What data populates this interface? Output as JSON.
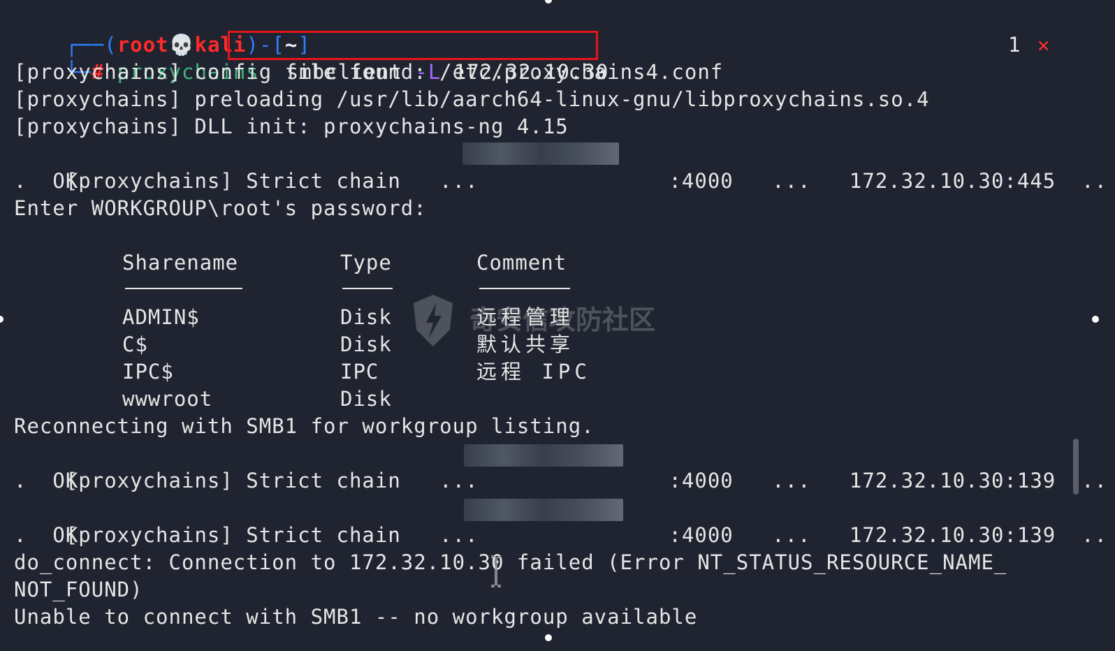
{
  "prompt": {
    "top_open": "┌──(",
    "user": "root",
    "skull": "💀",
    "host": "kali",
    "top_close": ")-[",
    "dir": "~",
    "bracket_close": "]",
    "bottom": "└─",
    "hash": "#",
    "proxy_word": "proxychains"
  },
  "command": {
    "program": "smbclient",
    "flag": "-L",
    "target": "172.32.10.30"
  },
  "right_status": {
    "exit_code": "1",
    "error_mark": "✕"
  },
  "output": {
    "l1": "[proxychains] config file found: /etc/proxychains4.conf",
    "l2": "[proxychains] preloading /usr/lib/aarch64-linux-gnu/libproxychains.so.4",
    "l3": "[proxychains] DLL init: proxychains-ng 4.15",
    "l4a": "[proxychains] Strict chain   ...  ",
    "l4b": ":4000   ...   172.32.10.30:445  ..",
    "l5": ".  OK",
    "l6": "Enter WORKGROUP\\root's password:",
    "l11": "Reconnecting with SMB1 for workgroup listing.",
    "l12a": "[proxychains] Strict chain   ...  ",
    "l12b": ":4000   ...   172.32.10.30:139  ..",
    "l13": ".  OK",
    "l14a": "[proxychains] Strict chain   ...  ",
    "l14b": ":4000   ...   172.32.10.30:139  ..",
    "l15": ".  OK",
    "l16": "do_connect: Connection to 172.32.10.30 failed (Error NT_STATUS_RESOURCE_NAME_",
    "l17": "NOT_FOUND)",
    "l18": "Unable to connect with SMB1 -- no workgroup available"
  },
  "shares_table": {
    "headers": [
      "Sharename",
      "Type",
      "Comment"
    ],
    "rows": [
      {
        "name": "ADMIN$",
        "type": "Disk",
        "comment": "远程管理"
      },
      {
        "name": "C$",
        "type": "Disk",
        "comment": "默认共享"
      },
      {
        "name": "IPC$",
        "type": "IPC",
        "comment": "远程 IPC"
      },
      {
        "name": "wwwroot",
        "type": "Disk",
        "comment": ""
      }
    ]
  },
  "watermark_text": "奇安信攻防社区",
  "colors": {
    "background": "#1f2430",
    "prompt_blue": "#2f7fff",
    "root_red": "#ff2a2a",
    "proxychains_green": "#3fb47f",
    "flag_purple": "#a06cff",
    "highlight_red": "#e5161b"
  }
}
